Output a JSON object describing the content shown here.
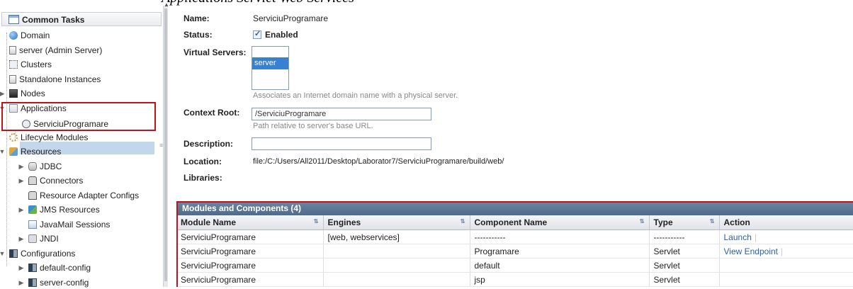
{
  "caption_fragment": "Applications Servlet Web Services",
  "sidebar": {
    "header": "Common Tasks",
    "items": [
      {
        "label": "Domain"
      },
      {
        "label": "server (Admin Server)"
      },
      {
        "label": "Clusters"
      },
      {
        "label": "Standalone Instances"
      },
      {
        "label": "Nodes"
      },
      {
        "label": "Applications"
      },
      {
        "label": "ServiciuProgramare"
      },
      {
        "label": "Lifecycle Modules"
      },
      {
        "label": "Resources"
      },
      {
        "label": "JDBC"
      },
      {
        "label": "Connectors"
      },
      {
        "label": "Resource Adapter Configs"
      },
      {
        "label": "JMS Resources"
      },
      {
        "label": "JavaMail Sessions"
      },
      {
        "label": "JNDI"
      },
      {
        "label": "Configurations"
      },
      {
        "label": "default-config"
      },
      {
        "label": "server-config"
      }
    ]
  },
  "form": {
    "name_label": "Name:",
    "name_value": "ServiciuProgramare",
    "status_label": "Status:",
    "status_value": "Enabled",
    "virtual_servers_label": "Virtual Servers:",
    "virtual_servers_option": "server",
    "virtual_servers_hint": "Associates an Internet domain name with a physical server.",
    "context_root_label": "Context Root:",
    "context_root_value": "/ServiciuProgramare",
    "context_root_hint": "Path relative to server's base URL.",
    "description_label": "Description:",
    "description_value": "",
    "location_label": "Location:",
    "location_value": "file:/C:/Users/All2011/Desktop/Laborator7/ServiciuProgramare/build/web/",
    "libraries_label": "Libraries:"
  },
  "table": {
    "title": "Modules and Components (4)",
    "columns": [
      "Module Name",
      "Engines",
      "Component Name",
      "Type",
      "Action"
    ],
    "rows": [
      [
        "ServiciuProgramare",
        "[web, webservices]",
        "-----------",
        "-----------",
        "Launch"
      ],
      [
        "ServiciuProgramare",
        "",
        "Programare",
        "Servlet",
        "View Endpoint"
      ],
      [
        "ServiciuProgramare",
        "",
        "default",
        "Servlet",
        ""
      ],
      [
        "ServiciuProgramare",
        "",
        "jsp",
        "Servlet",
        ""
      ]
    ]
  },
  "colors": {
    "accent": "#4f6a8b",
    "highlight": "#c0121c",
    "selection": "#c3d7ec",
    "link": "#2b62a8"
  }
}
